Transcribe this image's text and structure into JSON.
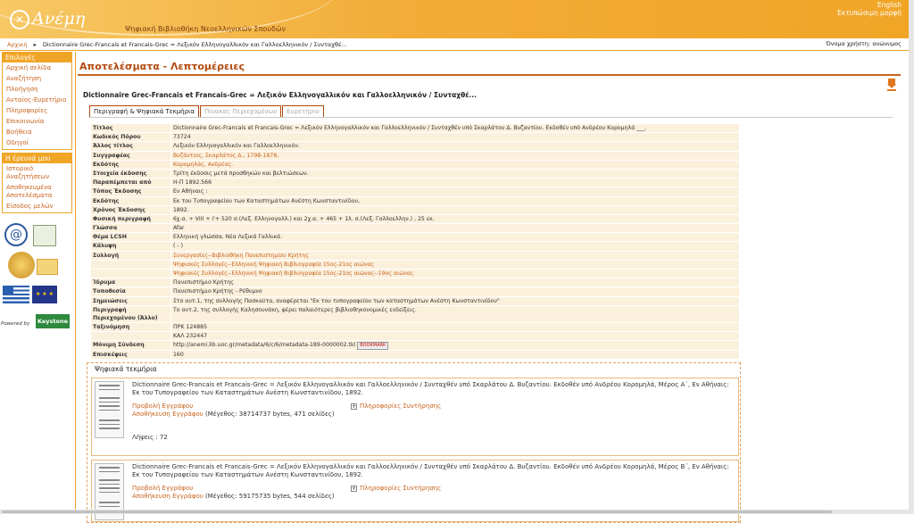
{
  "header": {
    "logo_text": "Ανέμη",
    "logo_glyph": "✕",
    "site_title": "Ψηφιακή Βιβλιοθήκη Νεοελληνικών Σπουδών",
    "lang_link": "English",
    "print_link": "Εκτυπώσιμη μορφή"
  },
  "breadcrumb": {
    "home": "Αρχική",
    "current": "Dictionnaire Grec-Francais et Francais-Grec = Λεξικόν Ελληνογαλλικόν και Γαλλοελληνικόν / Συνταχθέ...",
    "user_label": "Όνομα χρήστη:",
    "user_value": "ανώνυμος"
  },
  "sidebar": {
    "options_title": "Επιλογές",
    "options": [
      "Αρχική σελίδα",
      "Αναζήτηση",
      "Πλοήγηση",
      "Ανταίος-Ευρετήριο",
      "Πληροφορίες",
      "Επικοινωνία",
      "Βοήθεια",
      "Οδηγοί"
    ],
    "research_title": "Η έρευνά μου",
    "research": [
      "Ιστορικό Αναζητήσεων",
      "Αποθηκευμένα Αποτελέσματα",
      "Είσοδος μελών"
    ]
  },
  "logos": {
    "powered_by": "Powered by",
    "keystone": "Keystone",
    "eu": "★ ★ ★"
  },
  "main": {
    "title": "Αποτελέσματα - Λεπτομέρειες",
    "record_title": "Dictionnaire Grec-Francais et Francais-Grec = Λεξικόν Ελληνογαλλικόν και Γαλλοελληνικόν / Συνταχθέ...",
    "tabs": [
      "Περιγραφή & Ψηφιακά Τεκμήρια",
      "Πίνακας Περιεχομένων",
      "Ευρετήριο"
    ]
  },
  "metadata": [
    {
      "k": "Τίτλος",
      "v": "Dictionnaire Grec-Francais et Francais-Grec = Λεξικόν Ελληνογαλλικόν και Γαλλοελληνικόν / Συνταχθέν υπό Σκαρλάτου Δ. Βυζαντίου. Εκδοθέν υπό Ανδρέου Κορομηλά ___."
    },
    {
      "k": "Κωδικός Πόρου",
      "v": "73724"
    },
    {
      "k": "Άλλος τίτλος",
      "v": "Λεξικόν Ελληνογαλλικόν και Γαλλοελληνικόν."
    },
    {
      "k": "Συγγραφέας",
      "v": "Βυζάντιος, Σκαρλάτος Δ., 1798-1878.",
      "link": true
    },
    {
      "k": "Εκδότης",
      "v": "Κορομηλάς, Ανδρέας.",
      "link": true
    },
    {
      "k": "Στοιχεία έκδοσης",
      "v": "Τρίτη έκδοσις μετά προσθηκών και βελτιώσεων."
    },
    {
      "k": "Παραπέμπεται από",
      "v": "Η-Π 1892.566"
    },
    {
      "k": "Τόπος Έκδοσης",
      "v": "Εν Αθήναις :"
    },
    {
      "k": "Εκδότης",
      "v": "Εκ του Τυπογραφείου των Καταστημάτων Ανέστη Κωνσταντινίδου,"
    },
    {
      "k": "Χρόνος Έκδοσης",
      "v": "1892."
    },
    {
      "k": "Φυσική περιγραφή",
      "v": "6χ.α. + VIII + i'+ 520 σ.(Λεξ. Ελληνογαλλ.) και 2χ.α. + 465 + 1λ. σ.(Λεξ. Γαλλοελλην.) , 25 εκ."
    },
    {
      "k": "Γλώσσα",
      "v": "Afar"
    },
    {
      "k": "Θέμα LCSH",
      "v": "Ελληνική γλώσσα, Νέα Λεξικά Γαλλικά."
    },
    {
      "k": "Κάλυψη",
      "v": "( - )"
    },
    {
      "k": "Συλλογή",
      "v": "Συνεργασίες--Βιβλιοθήκη Πανεπιστημίου Κρήτης",
      "link": true
    },
    {
      "k": "",
      "v": "Ψηφιακές Συλλογές--Ελληνική Ψηφιακή Βιβλιογραφία 15ος-21ος αιώνας",
      "link": true
    },
    {
      "k": "",
      "v": "Ψηφιακές Συλλογές--Ελληνική Ψηφιακή Βιβλιογραφία 15ος-21ος αιώνας--19ος αιώνας",
      "link": true
    },
    {
      "k": "Ίδρυμα",
      "v": "Πανεπιστήμιο Κρήτης"
    },
    {
      "k": "Τοποθεσία",
      "v": "Πανεπιστήμιο Κρήτης - Ρέθυμνο"
    },
    {
      "k": "Σημειώσεις",
      "v": "Στο αντ.1, της συλλογής Πασκαύτα, αναφέρεται \"Εκ του τυπογραφείου των καταστημάτων Ανέστη Κωνσταντινίδου\""
    },
    {
      "k": "Περιγραφή Περιεχομένου (Άλλο)",
      "v": "Το αντ.2, της συλλογής Καλησουνάκη, φέρει παλαιότερες βιβλιοθηκονομικές ενδείξεις.",
      "tall": true
    },
    {
      "k": "Ταξινόμηση",
      "v": "ΠΡΚ 124885"
    },
    {
      "k": "",
      "v": "ΚΑΛ 232447"
    },
    {
      "k": "Μόνιμη Σύνδεση",
      "v": "http://anemi.lib.uoc.gr/metadata/6/c/6/metadata-189-0000002.tkl",
      "bookmark": "BOOKMARK"
    },
    {
      "k": "Επισκέψεις",
      "v": "160"
    }
  ],
  "digital": {
    "title": "Ψηφιακά τεκμήρια",
    "items": [
      {
        "text": "Dictionnaire Grec-Francais et Francais-Grec = Λεξικόν Ελληνογαλλικόν και Γαλλοελληνικόν / Συνταχθέν υπό Σκαρλάτου Δ. Βυζαντίου. Εκδοθέν υπό Ανδρέου Κορομηλά, Μέρος Α΄, Εν Αθήναις: Εκ του Τυπογραφείου των Καταστημάτων Ανέστη Κωνσταντινίδου, 1892.",
        "view": "Προβολή Εγγράφου",
        "save": "Αποθήκευση Εγγράφου",
        "size": "(Μέγεθος: 38714737 bytes, 471 σελίδες)",
        "info": "Πληροφορίες Συντήρησης",
        "hits": "Λήψεις : 72"
      },
      {
        "text": "Dictionnaire Grec-Francais et Francais-Grec = Λεξικόν Ελληνογαλλικόν και Γαλλοελληνικόν / Συνταχθέν υπό Σκαρλάτου Δ. Βυζαντίου. Εκδοθέν υπό Ανδρέου Κορομηλά, Μέρος Β΄, Εν Αθήναις: Εκ του Τυπογραφείου των Καταστημάτων Ανέστη Κωνσταντινίδου, 1892.",
        "view": "Προβολή Εγγράφου",
        "save": "Αποθήκευση Εγγράφου",
        "size": "(Μέγεθος: 59175735 bytes, 544 σελίδες)",
        "info": "Πληροφορίες Συντήρησης"
      }
    ]
  }
}
